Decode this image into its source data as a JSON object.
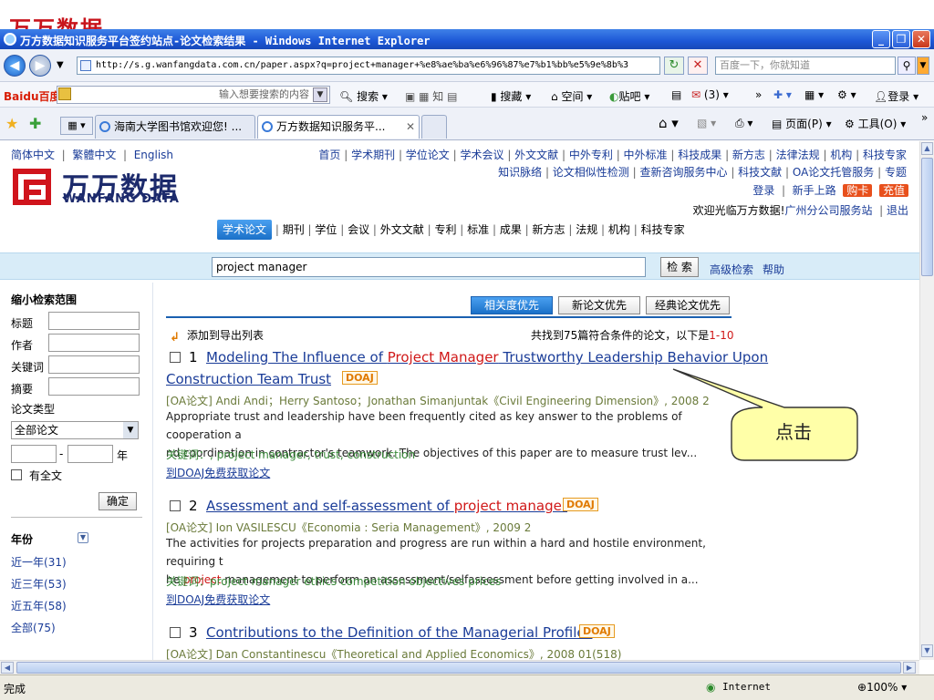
{
  "slide_peek": {
    "logo_text": "万万数据"
  },
  "window": {
    "title": "万方数据知识服务平台签约站点-论文检索结果 - Windows Internet Explorer",
    "minimize": "_",
    "restore": "❐",
    "close": "✕"
  },
  "address_bar": {
    "url": "http://s.g.wanfangdata.com.cn/paper.aspx?q=project+manager+%e8%ae%ba%e6%96%87%e7%b1%bb%e5%9e%8b%3",
    "search_placeholder": "百度一下，你就知道"
  },
  "baidu_toolbar": {
    "brand": "Baidu百度",
    "input_placeholder": "输入想要搜索的内容",
    "search": "搜索",
    "news": "搜藏",
    "space": "空间",
    "tieba": "贴吧",
    "count": "(3)",
    "login": "登录"
  },
  "tabs": [
    {
      "label": "海南大学图书馆欢迎您! ..."
    },
    {
      "label": "万方数据知识服务平..."
    }
  ],
  "ie_toolbar": {
    "page": "页面(P)",
    "tools": "工具(O)"
  },
  "site": {
    "lang_links": [
      "简体中文",
      "繁體中文",
      "English"
    ],
    "top_links_row1": [
      "首页",
      "学术期刊",
      "学位论文",
      "学术会议",
      "外文文献",
      "中外专利",
      "中外标准",
      "科技成果",
      "新方志",
      "法律法规",
      "机构",
      "科技专家"
    ],
    "top_links_row2": [
      "知识脉络",
      "论文相似性检测",
      "查新咨询服务中心",
      "科技文献",
      "OA论文托管服务",
      "专题"
    ],
    "login_links": [
      "登录",
      "新手上路"
    ],
    "buy_card": "购卡",
    "recharge": "充值",
    "welcome": "欢迎光临万方数据!",
    "org": "广州分公司服务站",
    "logout": "退出",
    "logo_cn": "万万数据",
    "logo_en": "WANFANG DATA",
    "nav_tabs": [
      "学术论文",
      "期刊",
      "学位",
      "会议",
      "外文文献",
      "专利",
      "标准",
      "成果",
      "新方志",
      "法规",
      "机构",
      "科技专家"
    ],
    "search_value": "project manager",
    "search_button": "检 索",
    "advanced": "高级检索",
    "help": "帮助"
  },
  "sidebar": {
    "title": "缩小检索范围",
    "fields": [
      "标题",
      "作者",
      "关键词",
      "摘要"
    ],
    "paper_type_label": "论文类型",
    "paper_type_value": "全部论文",
    "year_suffix": "年",
    "fulltext": "有全文",
    "confirm": "确定",
    "year_title": "年份",
    "year_items": [
      {
        "label": "近一年",
        "count": "(31)"
      },
      {
        "label": "近三年",
        "count": "(53)"
      },
      {
        "label": "近五年",
        "count": "(58)"
      },
      {
        "label": "全部",
        "count": "(75)"
      }
    ]
  },
  "results": {
    "sort_buttons": [
      "相关度优先",
      "新论文优先",
      "经典论文优先"
    ],
    "add_export": "添加到导出列表",
    "summary_prefix": "共找到75篇符合条件的论文，以下是",
    "summary_range": "1-10",
    "items": [
      {
        "num": "1",
        "title_pre": "Modeling The Influence of ",
        "title_hl": "Project Manager",
        "title_post": " Trustworthy Leadership Behavior Upon",
        "title_line2": "Construction Team Trust",
        "badge": "DOAJ",
        "meta": "[OA论文] Andi Andi；Herry Santoso；Jonathan Simanjuntak《Civil Engineering Dimension》, 2008 2",
        "abstract_1": "Appropriate trust and leadership have been frequently cited as key answer to the problems of cooperation a",
        "abstract_2": "nd coordination in contractor's teamwork. The objectives of this paper are to measure trust lev...",
        "keywords": "关键词：, project manager, trust, construction",
        "get": "到DOAJ免费获取论文"
      },
      {
        "num": "2",
        "title_pre": "Assessment and self-assessment of ",
        "title_hl": "project manager",
        "badge": "DOAJ",
        "meta": "[OA论文] Ion VASILESCU《Economia : Seria Management》, 2009 2",
        "abstract_1": "The activities for projects preparation and progress are run within a hard and hostile environment, requiring t",
        "abstract_2_pre": "he ",
        "abstract_2_hl": "project",
        "abstract_2_post": " management to perform an assessment/selfassessment before getting involved in a...",
        "keywords": "关键词：project manager ethics competition objectives prices",
        "get": "到DOAJ免费获取论文"
      },
      {
        "num": "3",
        "title": "Contributions to the Definition of the Managerial Profiles",
        "badge": "DOAJ",
        "meta": "[OA论文] Dan Constantinescu《Theoretical and Applied Economics》, 2008 01(518)"
      }
    ]
  },
  "callout": {
    "text": "点击"
  },
  "statusbar": {
    "left": "完成",
    "zone": "Internet",
    "zoom": "100%"
  }
}
